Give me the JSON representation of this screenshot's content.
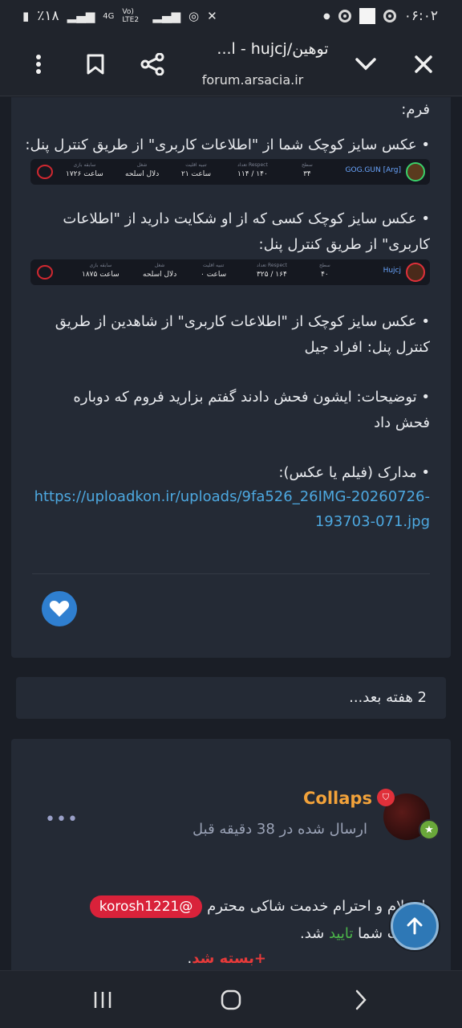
{
  "status_bar": {
    "time": "۰۶:۰۲",
    "battery": "٪۱۸",
    "network": "4G",
    "volte": "Vo) LTE2"
  },
  "browser": {
    "title": "توهین/hujcj - ا...",
    "url": "forum.arsacia.ir",
    "icons": [
      "close-icon",
      "chevron-down-icon",
      "share-icon",
      "bookmark-icon",
      "more-vertical-icon"
    ]
  },
  "post1": {
    "line_form": "فرم:",
    "line_own": "• عکس سایز کوچک شما از \"اطلاعات کاربری\" از طریق کنترل پنل:",
    "stat_own": {
      "name": "GOG.GUN [Arg]",
      "cols": [
        {
          "h": "سطح",
          "v": "۳۴"
        },
        {
          "h": "تعداد Respect",
          "v": "۱۱۴ / ۱۴۰"
        },
        {
          "h": "تنبیه اقلیت",
          "v": "۲۱ ساعت"
        },
        {
          "h": "شغل",
          "v": "دلال اسلحه"
        },
        {
          "h": "سابقه بازی",
          "v": "۱۷۲۶ ساعت"
        }
      ]
    },
    "line_target_1": "• عکس سایز کوچک کسی که از او شکایت دارید از \"اطلاعات",
    "line_target_2": "کاربری\" از طریق کنترل پنل:",
    "stat_target": {
      "name": "Hujcj",
      "cols": [
        {
          "h": "سطح",
          "v": "۴۰"
        },
        {
          "h": "تعداد Respect",
          "v": "۳۲۵ / ۱۶۴"
        },
        {
          "h": "تنبیه اقلیت",
          "v": "۰ ساعت"
        },
        {
          "h": "شغل",
          "v": "دلال اسلحه"
        },
        {
          "h": "سابقه بازی",
          "v": "۱۸۷۵ ساعت"
        }
      ]
    },
    "line_witness_1": "• عکس سایز کوچک از \"اطلاعات کاربری\" از شاهدین از طریق",
    "line_witness_2": "کنترل پنل: افراد جیل",
    "line_desc_1": "• توضیحات: ایشون فحش دادند گفتم بزارید فروم که دوباره",
    "line_desc_2": "فحش داد",
    "line_evidence": "• مدارک (فیلم یا عکس):",
    "link_1": "https://uploadkon.ir/uploads/9fa526_26IMG-20260726-",
    "link_2": "193703-071.jpg"
  },
  "time_gap": "2 هفته بعد...",
  "post2": {
    "username": "Collaps",
    "posted": "ارسال شده در 38 دقیقه قبل",
    "more": "•••",
    "mention": "korosh1221@",
    "line1_text": "با سلام و احترام خدمت شاکی محترم",
    "line2_pre": "شکایت شما",
    "line2_green": "تایید",
    "line2_post": "شد.",
    "line3_red": "+بسته شد",
    "line3_post": "."
  },
  "colors": {
    "background": "#1a1e26",
    "card": "#242a35",
    "link": "#4da8e0",
    "username": "#f2a23a",
    "mention": "#d9223a",
    "approved": "#4cb84a",
    "closed": "#e63a3a"
  }
}
